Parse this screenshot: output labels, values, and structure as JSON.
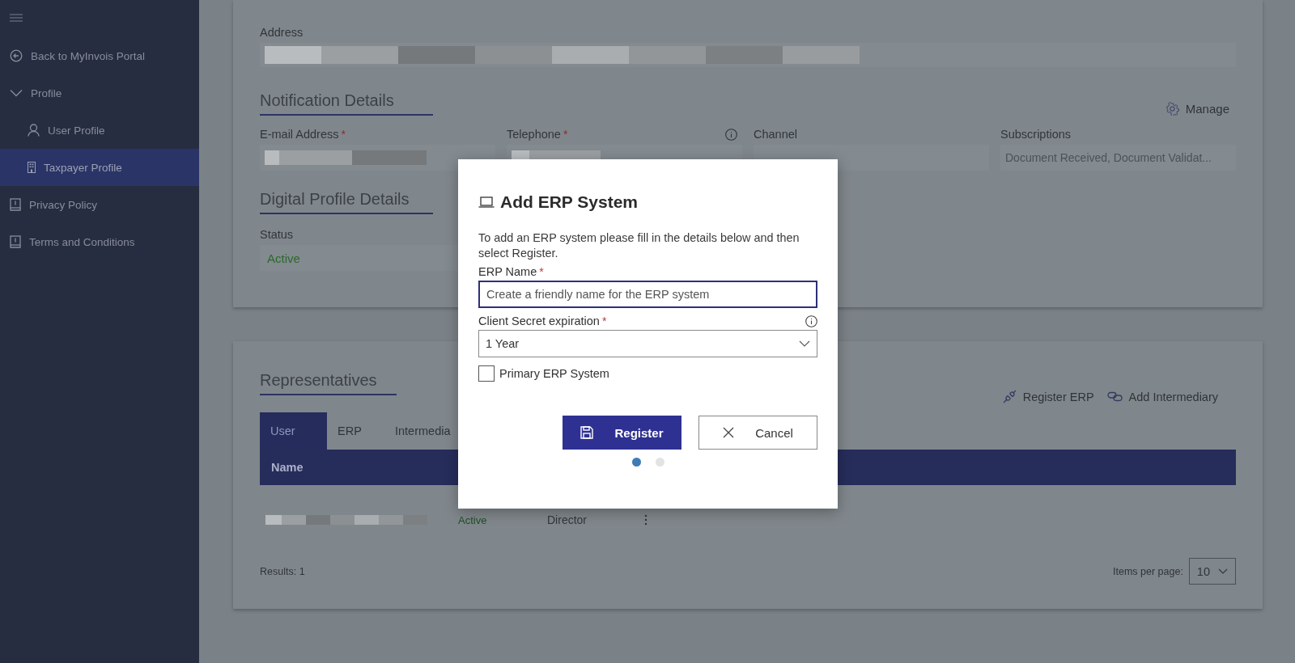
{
  "sidebar": {
    "items": [
      {
        "kind": "back",
        "label": "Back to MyInvois Portal",
        "selected": false
      },
      {
        "kind": "group",
        "label": "Profile",
        "expanded": true,
        "selected": false,
        "children": [
          {
            "kind": "user",
            "label": "User Profile",
            "selected": false
          },
          {
            "kind": "building",
            "label": "Taxpayer Profile",
            "selected": true
          }
        ]
      },
      {
        "kind": "book",
        "label": "Privacy Policy",
        "selected": false
      },
      {
        "kind": "book",
        "label": "Terms and Conditions",
        "selected": false
      }
    ]
  },
  "profile_card": {
    "address": {
      "label": "Address",
      "redacted": true
    },
    "notification": {
      "title": "Notification Details",
      "action": "Manage",
      "fields": [
        {
          "label": "E-mail Address",
          "asterisk": "*",
          "redacted": true
        },
        {
          "label": "Telephone",
          "asterisk": "*",
          "info": true,
          "redacted": true
        },
        {
          "label": "Channel",
          "redacted": false
        },
        {
          "label": "Subscriptions",
          "redacted": false,
          "value": "Document Received, Document Validat..."
        }
      ]
    },
    "digital_profile": {
      "title": "Digital Profile Details",
      "status_label": "Status",
      "status": "Active"
    }
  },
  "representatives": {
    "title": "Representatives",
    "actions": [
      {
        "kind": "plug",
        "label": "Register ERP"
      },
      {
        "kind": "link",
        "label": "Add Intermediary"
      }
    ],
    "tabs": [
      {
        "label": "User",
        "selected": true
      },
      {
        "label": "ERP",
        "selected": false
      },
      {
        "label": "Intermedia",
        "selected": false
      }
    ],
    "table": {
      "columns": [
        "Name"
      ],
      "rows": [
        {
          "name_redacted": true,
          "status": "Active",
          "role": "Director"
        }
      ]
    },
    "results": "Results: 1",
    "items_per_page": {
      "label": "Items per page:",
      "value": "10"
    }
  },
  "dialog": {
    "title": "Add ERP System",
    "description": "To add an ERP system please fill in the details below and then select Register.",
    "fields": [
      {
        "kind": "text",
        "label": "ERP Name",
        "asterisk": "*",
        "placeholder": "Create a friendly name for the ERP system",
        "focused": true
      },
      {
        "kind": "select",
        "label": "Client Secret expiration",
        "asterisk": "*",
        "info": true,
        "value": "1 Year",
        "focused": false
      }
    ],
    "checkbox": {
      "label": "Primary ERP System",
      "checked": false
    },
    "buttons": [
      {
        "kind": "primary",
        "label": "Register"
      },
      {
        "kind": "secondary",
        "label": "Cancel"
      }
    ],
    "steps": [
      {
        "selected": true
      },
      {
        "selected": false
      }
    ]
  }
}
